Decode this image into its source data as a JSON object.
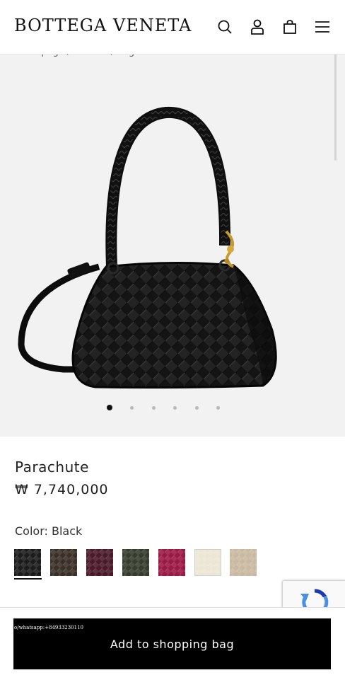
{
  "header": {
    "logo": "BOTTEGA VENETA",
    "icons": [
      "search-icon",
      "account-icon",
      "shopping-bag-icon",
      "menu-icon"
    ]
  },
  "breadcrumb": "Homepage / Women / Bags",
  "gallery": {
    "slide_count": 6,
    "active_index": 0
  },
  "product": {
    "name": "Parachute",
    "price": "₩ 7,740,000",
    "color_label": "Color: Black",
    "swatches": [
      {
        "name": "Black",
        "color": "#1c1c1c"
      },
      {
        "name": "Brown",
        "color": "#3a3028"
      },
      {
        "name": "Plum",
        "color": "#4a1a2a"
      },
      {
        "name": "Olive",
        "color": "#353d2e"
      },
      {
        "name": "Raspberry",
        "color": "#9a1a45"
      },
      {
        "name": "Cream",
        "color": "#ece6d4"
      },
      {
        "name": "Taupe",
        "color": "#c9b9a1"
      }
    ],
    "selected_swatch": 0
  },
  "bottom": {
    "whatsapp_link": "o/whatsapp:+84933230110",
    "cta_label": "Add to shopping bag"
  }
}
